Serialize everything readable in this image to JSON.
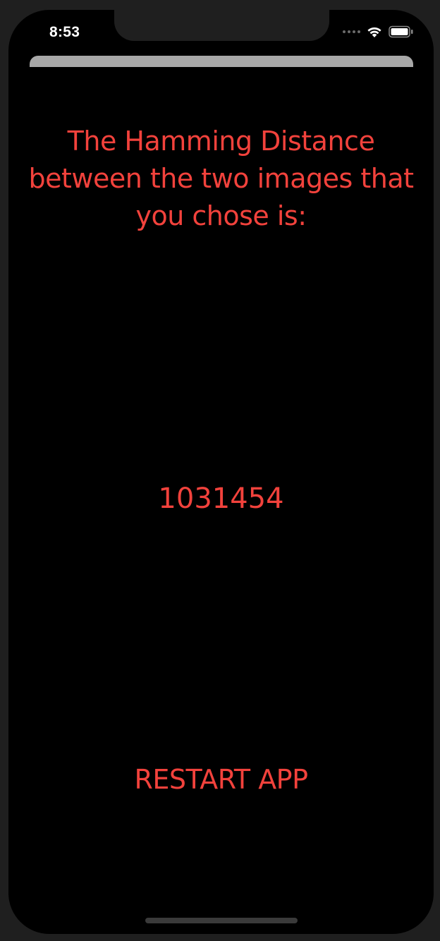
{
  "status_bar": {
    "time": "8:53",
    "icons": [
      "cellular-signal-icon",
      "wifi-icon",
      "battery-icon"
    ]
  },
  "result": {
    "heading": "The Hamming Distance between the two images that you chose is:",
    "value": "1031454"
  },
  "actions": {
    "restart_label": "RESTART APP"
  },
  "colors": {
    "accent": "#f2423c",
    "background": "#000000",
    "sheet_handle": "#a8a8a8"
  }
}
